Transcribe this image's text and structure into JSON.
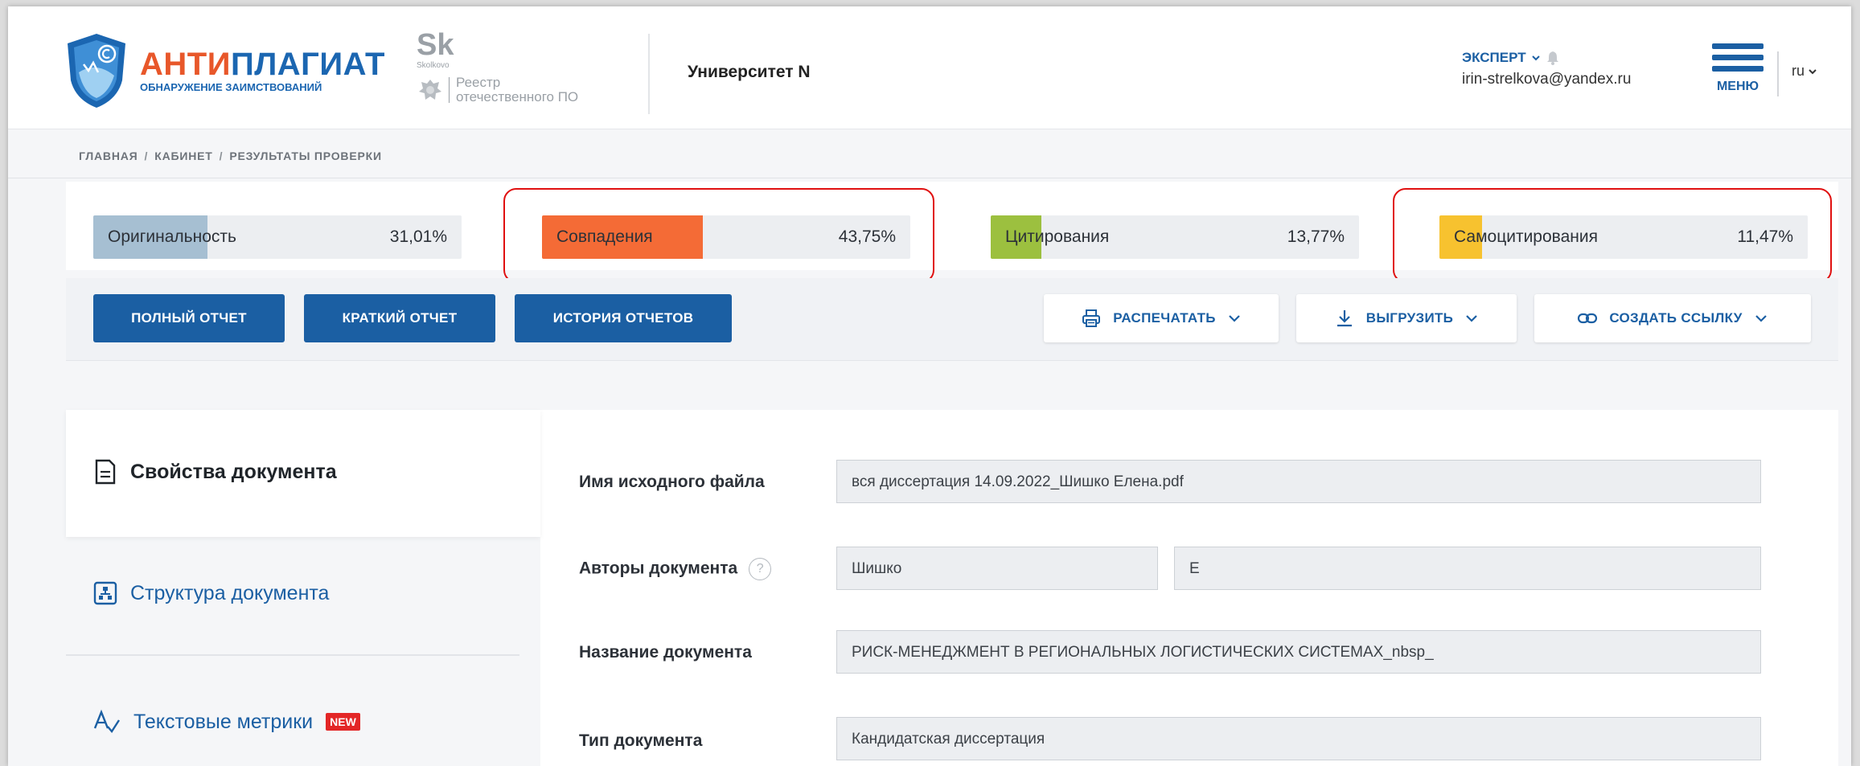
{
  "header": {
    "logo": {
      "title_part1": "АНТИ",
      "title_part2": "ПЛАГИАТ",
      "subtitle": "ОБНАРУЖЕНИЕ ЗАИМСТВОВАНИЙ"
    },
    "skolkovo": {
      "mark": "Sk",
      "caption": "Skolkovo"
    },
    "registry": {
      "line1": "Реестр",
      "line2": "отечественного ПО"
    },
    "organization": "Университет N",
    "user": {
      "role": "ЭКСПЕРТ",
      "email": "irin-strelkova@yandex.ru"
    },
    "menu_label": "МЕНЮ",
    "language": "ru"
  },
  "breadcrumb": [
    "ГЛАВНАЯ",
    "КАБИНЕТ",
    "РЕЗУЛЬТАТЫ ПРОВЕРКИ"
  ],
  "breadcrumb_sep": "/",
  "metrics": [
    {
      "label": "Оригинальность",
      "value": "31,01%",
      "fraction": 0.3101,
      "color": "#a6bfd2",
      "highlighted": false
    },
    {
      "label": "Совпадения",
      "value": "43,75%",
      "fraction": 0.4375,
      "color": "#f46b36",
      "highlighted": true
    },
    {
      "label": "Цитирования",
      "value": "13,77%",
      "fraction": 0.1377,
      "color": "#9cc03f",
      "highlighted": false
    },
    {
      "label": "Самоцитирования",
      "value": "11,47%",
      "fraction": 0.1147,
      "color": "#f7c22f",
      "highlighted": true
    }
  ],
  "toolbar": {
    "full_report": "ПОЛНЫЙ ОТЧЕТ",
    "short_report": "КРАТКИЙ ОТЧЕТ",
    "report_history": "ИСТОРИЯ ОТЧЕТОВ",
    "print": "РАСПЕЧАТАТЬ",
    "export": "ВЫГРУЗИТЬ",
    "create_link": "СОЗДАТЬ ССЫЛКУ"
  },
  "sidebar": {
    "items": [
      {
        "label": "Свойства документа",
        "active": true
      },
      {
        "label": "Структура документа",
        "active": false
      },
      {
        "label": "Текстовые метрики",
        "active": false,
        "badge": "NEW"
      }
    ]
  },
  "properties": {
    "file_name_label": "Имя исходного файла",
    "file_name_value": "вся диссертация 14.09.2022_Шишко Елена.pdf",
    "authors_label": "Авторы документа",
    "help_symbol": "?",
    "author_last_name": "Шишко",
    "author_initial": "Е",
    "title_label": "Название документа",
    "title_value": "РИСК-МЕНЕДЖМЕНТ В РЕГИОНАЛЬНЫХ ЛОГИСТИЧЕСКИХ СИСТЕМАХ_nbsp_",
    "type_label": "Тип документа",
    "type_value": "Кандидатская диссертация"
  },
  "colors": {
    "brand_blue": "#1b5fa3",
    "brand_orange": "#e8572a",
    "highlight_red": "#e01010",
    "badge_red": "#e32626"
  }
}
